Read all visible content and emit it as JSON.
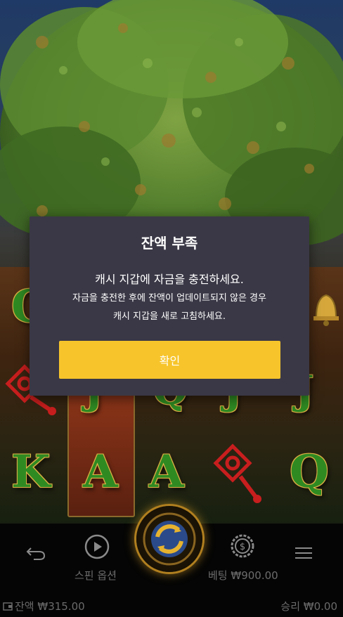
{
  "dialog": {
    "title": "잔액 부족",
    "message": "캐시 지갑에 자금을 충전하세요.",
    "sub_line1": "자금을 충전한 후에 잔액이 업데이트되지 않은 경우",
    "sub_line2": "캐시 지갑을 새로 고침하세요.",
    "confirm_label": "확인"
  },
  "reels": {
    "row_top": [
      "Q"
    ],
    "row_mid": [
      "J",
      "Q",
      "J",
      "J"
    ],
    "row_bottom": [
      "K",
      "A",
      "A",
      "Q"
    ]
  },
  "bottom_bar": {
    "spin_options_label": "스핀 옵션",
    "bet_label": "베팅 ₩900.00"
  },
  "footer": {
    "balance_label": "잔액 ₩315.00",
    "win_label": "승리 ₩0.00"
  },
  "colors": {
    "accent": "#f7c52b",
    "dialog_bg": "#3a3846",
    "symbol_green": "#2f8a22",
    "gold": "#d6a83c"
  },
  "icons": [
    "back-icon",
    "play-icon",
    "spin-icon",
    "coin-icon",
    "menu-icon",
    "wallet-icon"
  ]
}
